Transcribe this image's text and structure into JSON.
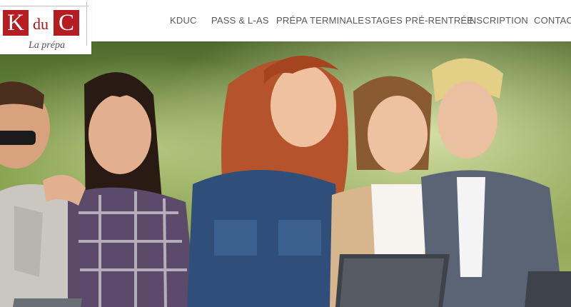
{
  "logo": {
    "letter_left": "K",
    "middle": "du",
    "letter_right": "C",
    "tagline": "La prépa"
  },
  "nav": {
    "items": [
      "KDUC",
      "PASS & L-AS",
      "PRÉPA TERMINALE",
      "STAGES PRÉ-RENTRÉE",
      "INSCRIPTION",
      "CONTACT"
    ]
  },
  "colors": {
    "brand_red": "#b51d22",
    "nav_text": "#55595c",
    "header_bg": "#ffffff"
  },
  "hero": {
    "icon": "students-photo"
  }
}
